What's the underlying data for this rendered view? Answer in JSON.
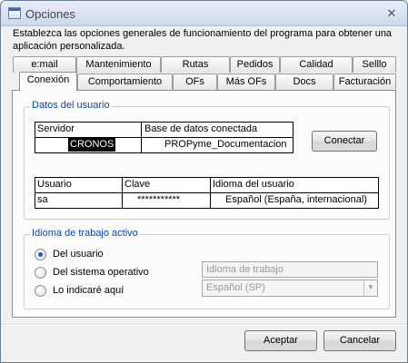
{
  "window": {
    "title": "Opciones",
    "close_glyph": "✕"
  },
  "intro_text": "Establezca las opciones generales de funcionamiento del programa para obtener una aplicación personalizada.",
  "tabs_row1": [
    {
      "label": "e:mail"
    },
    {
      "label": "Mantenimiento"
    },
    {
      "label": "Rutas"
    },
    {
      "label": "Pedidos"
    },
    {
      "label": "Calidad"
    },
    {
      "label": "Selllo"
    }
  ],
  "tabs_row2": [
    {
      "label": "Conexión",
      "active": true
    },
    {
      "label": "Comportamiento"
    },
    {
      "label": "OFs"
    },
    {
      "label": "Más OFs"
    },
    {
      "label": "Docs"
    },
    {
      "label": "Facturación"
    }
  ],
  "datos_usuario": {
    "legend": "Datos del usuario",
    "server_header": "Servidor",
    "db_header": "Base de datos conectada",
    "server_value": "CRONOS",
    "db_value": "PROPyme_Documentacion",
    "connect_button": "Conectar",
    "user_header": "Usuario",
    "password_header": "Clave",
    "language_header": "Idioma del usuario",
    "user_value": "sa",
    "password_value": "***********",
    "language_value": "Español (España, internacional)"
  },
  "idioma_trabajo": {
    "legend": "Idioma de trabajo activo",
    "options": [
      {
        "label": "Del usuario",
        "checked": true
      },
      {
        "label": "Del sistema operativo",
        "checked": false
      },
      {
        "label": "Lo indicaré aquí",
        "checked": false
      }
    ],
    "field_placeholder": "Idioma de trabajo",
    "combo_value": "Español (SP)",
    "combo_arrow": "▼"
  },
  "footer": {
    "accept": "Aceptar",
    "cancel": "Cancelar"
  },
  "colors": {
    "accent": "#0a46b5",
    "selection": "#000000"
  }
}
